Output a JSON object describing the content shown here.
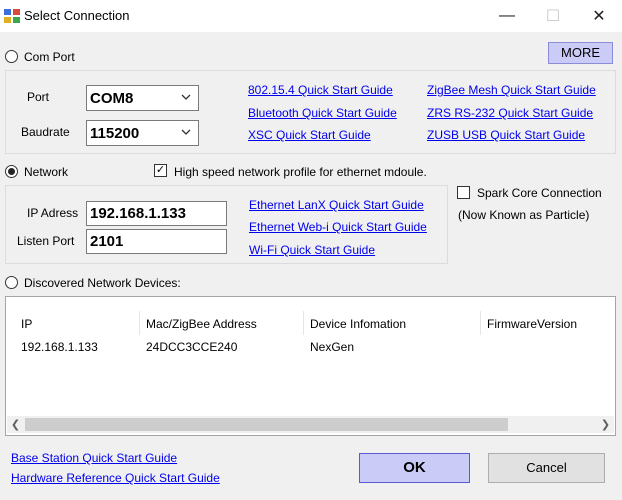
{
  "window": {
    "title": "Select Connection",
    "min_glyph": "—",
    "max_glyph": "☐",
    "close_glyph": "✕"
  },
  "com_port": {
    "radio_label": "Com Port",
    "more_label": "MORE",
    "port_label": "Port",
    "port_value": "COM8",
    "baud_label": "Baudrate",
    "baud_value": "115200",
    "links": [
      "802.15.4 Quick Start Guide",
      "Bluetooth Quick Start Guide",
      "XSC Quick Start Guide",
      "ZigBee Mesh Quick Start Guide",
      "ZRS RS-232 Quick Start Guide",
      "ZUSB USB Quick Start Guide"
    ]
  },
  "network": {
    "radio_label": "Network",
    "high_speed_label": "High speed network profile for ethernet mdoule.",
    "high_speed_checked": "✓",
    "ip_label": "IP Adress",
    "ip_value": "192.168.1.133",
    "port_label": "Listen Port",
    "port_value": "2101",
    "links": [
      "Ethernet LanX Quick Start Guide",
      "Ethernet Web-i Quick Start Guide",
      "Wi-Fi Quick Start Guide"
    ],
    "spark_label": "Spark Core Connection",
    "spark_sub": "(Now Known as Particle)"
  },
  "discovered": {
    "radio_label": "Discovered Network Devices:",
    "columns": [
      "IP",
      "Mac/ZigBee Address",
      "Device Infomation",
      "FirmwareVersion"
    ],
    "rows": [
      [
        "192.168.1.133",
        "24DCC3CCE240",
        "NexGen",
        ""
      ]
    ],
    "scroll_left": "❮",
    "scroll_right": "❯"
  },
  "footer": {
    "link1": "Base Station Quick Start Guide",
    "link2": "Hardware Reference Quick Start Guide",
    "ok": "OK",
    "cancel": "Cancel"
  },
  "colors": {
    "accent_button": "#cbcbf7",
    "link": "#0000ee"
  }
}
